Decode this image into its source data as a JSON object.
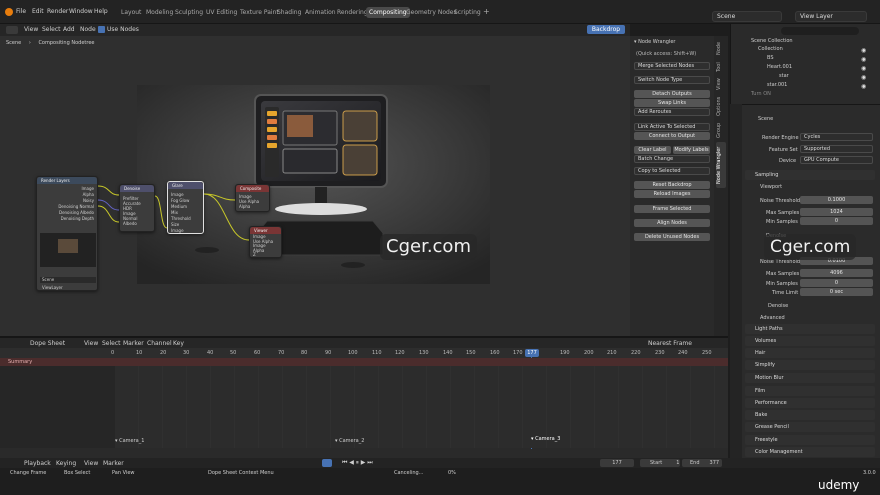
{
  "menu": [
    "File",
    "Edit",
    "Render",
    "Window",
    "Help"
  ],
  "workspaces": [
    "Layout",
    "Modeling",
    "Sculpting",
    "UV Editing",
    "Texture Paint",
    "Shading",
    "Animation",
    "Rendering",
    "Compositing",
    "Geometry Nodes",
    "Scripting"
  ],
  "active_workspace_index": 8,
  "scene": {
    "name": "Scene",
    "view_layer": "View Layer"
  },
  "node_header": {
    "menus": [
      "View",
      "Select",
      "Add",
      "Node"
    ],
    "use_nodes": "Use Nodes",
    "backdrop": "Backdrop"
  },
  "breadcrumb": {
    "scene": "Scene",
    "tree": "Compositing Nodetree"
  },
  "sidebar": {
    "title": "Node Wrangler",
    "quick": "(Quick access: Shift+W)",
    "merge": "Merge Selected Nodes",
    "switch": "Switch Node Type",
    "detach": "Detach Outputs",
    "swap": "Swap Links",
    "add_reroutes": "Add Reroutes",
    "link_active": "Link Active To Selected",
    "connect": "Connect to Output",
    "clear_label": "Clear Label",
    "modify_labels": "Modify Labels",
    "batch": "Batch Change",
    "copy": "Copy to Selected",
    "reset_backdrop": "Reset Backdrop",
    "reload_images": "Reload Images",
    "frame_selected": "Frame Selected",
    "align_nodes": "Align Nodes",
    "delete_unused": "Delete Unused Nodes"
  },
  "vtabs": [
    "Node",
    "Tool",
    "View",
    "Options",
    "Group",
    "Node Wrangler"
  ],
  "outliner": {
    "rows": [
      {
        "label": "Scene Collection"
      },
      {
        "label": "Collection"
      },
      {
        "label": "BS"
      },
      {
        "label": "Heart.001"
      },
      {
        "label": "star"
      },
      {
        "label": "star.001"
      },
      {
        "label": "Turn ON"
      }
    ]
  },
  "properties": {
    "scene": "Scene",
    "render_engine_label": "Render Engine",
    "render_engine": "Cycles",
    "feature_set_label": "Feature Set",
    "feature_set": "Supported",
    "device_label": "Device",
    "device": "GPU Compute",
    "sampling": "Sampling",
    "viewport": "Viewport",
    "noise_threshold_label": "Noise Threshold",
    "noise_threshold": "0.1000",
    "max_samples_label": "Max Samples",
    "max_samples": "1024",
    "min_samples_label": "Min Samples",
    "min_samples": "0",
    "denoise": "Denoise",
    "render_noise_threshold": "0.0100",
    "render_max_samples": "4096",
    "render_min_samples": "0",
    "time_limit_label": "Time Limit",
    "time_limit": "0 sec",
    "advanced": "Advanced",
    "sections": [
      "Light Paths",
      "Volumes",
      "Hair",
      "Simplify",
      "Motion Blur",
      "Film",
      "Performance",
      "Bake",
      "Grease Pencil",
      "Freestyle",
      "Color Management"
    ]
  },
  "dopesheet": {
    "mode": "Dope Sheet",
    "menus": [
      "View",
      "Select",
      "Marker",
      "Channel",
      "Key"
    ],
    "snap": "Nearest Frame",
    "summary": "Summary",
    "ticks": [
      "0",
      "10",
      "20",
      "30",
      "40",
      "50",
      "60",
      "70",
      "80",
      "90",
      "100",
      "110",
      "120",
      "130",
      "140",
      "150",
      "160",
      "170",
      "190",
      "200",
      "210",
      "220",
      "230",
      "240",
      "250"
    ],
    "current_frame": "177",
    "markers": [
      "Camera_1",
      "Camera_2",
      "Camera_3"
    ]
  },
  "playback": {
    "playback": "Playback",
    "keying": "Keying",
    "view": "View",
    "marker": "Marker",
    "frame": "177",
    "start_label": "Start",
    "start": "1",
    "end_label": "End",
    "end": "377"
  },
  "statusbar": {
    "change_frame": "Change Frame",
    "box_select": "Box Select",
    "pan_view": "Pan View",
    "context": "Dope Sheet Context Menu",
    "cancel": "Canceling...",
    "percent": "0%",
    "version": "3.0.0"
  },
  "nodes": {
    "render_layers": "Render Layers",
    "denoise": "Denoise",
    "glare": "Glare",
    "composite": "Composite",
    "viewer": "Viewer",
    "rl_outputs": [
      "Image",
      "Alpha",
      "Noisy",
      "Denoising Normal",
      "Denoising Albedo",
      "Denoising Depth"
    ],
    "rl_scene": "Scene",
    "rl_layer": "ViewLayer",
    "denoise_opts": [
      "Prefilter",
      "Accurate",
      "HDR",
      "Image",
      "Normal",
      "Albedo"
    ],
    "glare_opts": [
      "Image",
      "Fog Glow",
      "Medium",
      "Mix",
      "Threshold",
      "Size",
      "Image"
    ],
    "composite_opts": [
      "Image",
      "Use Alpha",
      "Alpha"
    ],
    "viewer_opts": [
      "Image",
      "Use Alpha",
      "Image",
      "Alpha",
      "Z"
    ]
  },
  "watermark": {
    "text": "Cger.com",
    "brand": "udemy"
  },
  "colors": {
    "accent": "#4772b3",
    "active_tab": "#4a4a4a",
    "summary": "#4b2c2c"
  }
}
